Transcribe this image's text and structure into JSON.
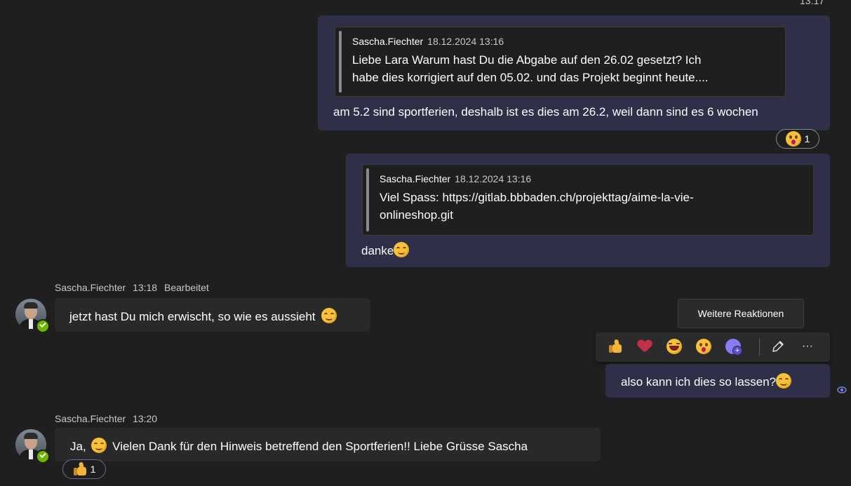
{
  "top_time": "13:17",
  "messages": [
    {
      "quote": {
        "author": "Sascha.Fiechter",
        "time": "18.12.2024 13:16",
        "line1": "Liebe Lara Warum hast Du die Abgabe auf den 26.02 gesetzt? Ich",
        "line2": "habe dies korrigiert auf den 05.02. und das Projekt beginnt heute...."
      },
      "text": "am 5.2 sind sportferien, deshalb ist es dies am 26.2, weil dann sind es 6 wochen",
      "reaction": {
        "emoji": "surprised-emoji",
        "count": "1"
      }
    },
    {
      "quote": {
        "author": "Sascha.Fiechter",
        "time": "18.12.2024 13:16",
        "line1": "Viel Spass: https://gitlab.bbbaden.ch/projekttag/aime-la-vie-",
        "line2": "onlineshop.git"
      },
      "text": "danke"
    },
    {
      "author": "Sascha.Fiechter",
      "time": "13:18",
      "edited": "Bearbeitet",
      "text": "jetzt hast Du mich erwischt, so wie es aussieht"
    },
    {
      "text": "also kann ich dies so lassen?"
    },
    {
      "author": "Sascha.Fiechter",
      "time": "13:20",
      "text_before": "Ja,",
      "text_after": "Vielen Dank für den Hinweis betreffend den Sportferien!! Liebe Grüsse Sascha",
      "reaction": {
        "emoji": "thumbs-up-emoji",
        "count": "1"
      }
    }
  ],
  "tooltip": "Weitere Reaktionen",
  "reaction_bar": {
    "items": [
      "thumbs-up-icon",
      "heart-icon",
      "laugh-icon",
      "surprised-icon",
      "add-reaction-icon",
      "edit-icon",
      "more-icon"
    ],
    "more_label": "···"
  },
  "colors": {
    "background": "#1f1f1f",
    "own_bubble": "#2f2f4a",
    "other_bubble": "#292929",
    "presence": "#6bb700"
  }
}
